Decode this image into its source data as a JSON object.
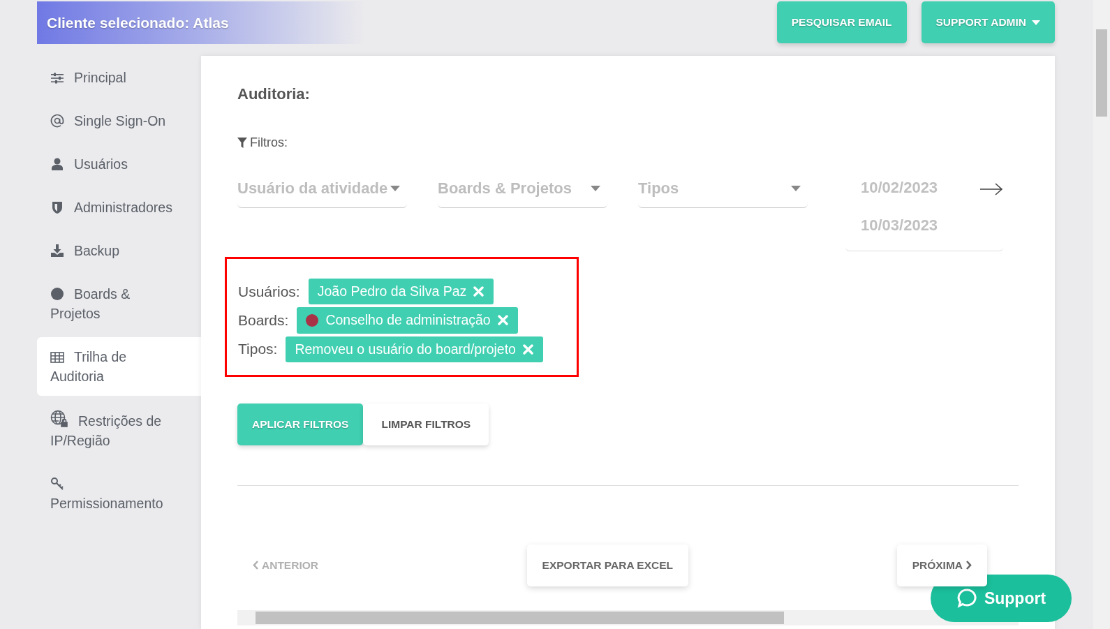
{
  "header": {
    "title": "Cliente selecionado: Atlas",
    "buttons": [
      {
        "label": "PESQUISAR EMAIL",
        "kind": "plain"
      },
      {
        "label": "SUPPORT ADMIN",
        "kind": "dropdown"
      }
    ]
  },
  "sidebar": {
    "items": [
      {
        "label": "Principal",
        "kind": "sliders",
        "selected": false
      },
      {
        "label": "Single Sign-On",
        "kind": "at",
        "selected": false
      },
      {
        "label": "Usuários",
        "kind": "user",
        "selected": false
      },
      {
        "label": "Administradores",
        "kind": "shield",
        "selected": false
      },
      {
        "label": "Backup",
        "kind": "download",
        "selected": false
      },
      {
        "label": "Boards & Projetos",
        "kind": "circle",
        "selected": false
      },
      {
        "label": "Trilha de Auditoria",
        "kind": "table",
        "selected": true
      },
      {
        "label": "Restrições de IP/Região",
        "kind": "globe",
        "selected": false
      },
      {
        "label": "Permissionamento",
        "kind": "key",
        "selected": false
      }
    ]
  },
  "content": {
    "title": "Auditoria:",
    "filter_label": "Filtros:",
    "selects": [
      {
        "placeholder": "Usuário da atividade"
      },
      {
        "placeholder": "Boards & Projetos"
      },
      {
        "placeholder": "Tipos"
      }
    ],
    "date_range": {
      "start": {
        "placeholder": "10/02/2023"
      },
      "end": {
        "placeholder": "10/03/2023"
      }
    },
    "active_filters": [
      {
        "label": "Usuários:",
        "chips": [
          {
            "text": "João Pedro da Silva Paz"
          }
        ]
      },
      {
        "label": "Boards:",
        "chips": [
          {
            "text": "Conselho de administração",
            "color": "#a83246"
          }
        ]
      },
      {
        "label": "Tipos:",
        "chips": [
          {
            "text": "Removeu o usuário do board/projeto"
          }
        ]
      }
    ],
    "actions": [
      {
        "label": "APLICAR FILTROS",
        "kind": "primary"
      },
      {
        "label": "LIMPAR FILTROS",
        "kind": "secondary"
      }
    ],
    "pagination": {
      "previous": {
        "label": "ANTERIOR",
        "disabled": true
      },
      "export": "EXPORTAR PARA EXCEL",
      "next": {
        "label": "PRÓXIMA",
        "disabled": false
      }
    }
  },
  "support_button": {
    "label": "Support"
  }
}
